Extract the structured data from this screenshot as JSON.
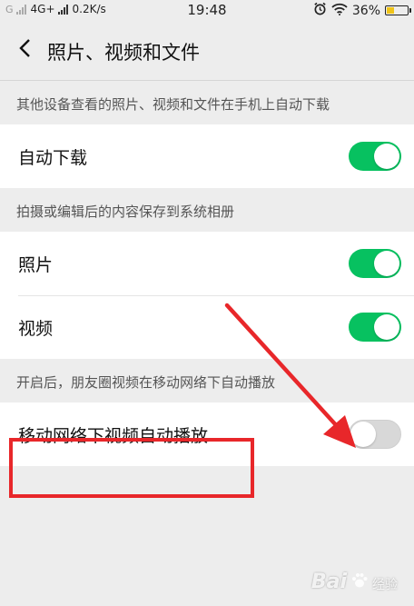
{
  "status_bar": {
    "carrier_g": "G",
    "network": "4G+",
    "speed": "0.2K/s",
    "time": "19:48",
    "battery": "36%"
  },
  "nav": {
    "title": "照片、视频和文件"
  },
  "sections": [
    {
      "header": "其他设备查看的照片、视频和文件在手机上自动下载",
      "items": [
        {
          "label": "自动下载",
          "on": true
        }
      ]
    },
    {
      "header": "拍摄或编辑后的内容保存到系统相册",
      "items": [
        {
          "label": "照片",
          "on": true
        },
        {
          "label": "视频",
          "on": true
        }
      ]
    },
    {
      "header": "开启后，朋友圈视频在移动网络下自动播放",
      "items": [
        {
          "label": "移动网络下视频自动播放",
          "on": false
        }
      ]
    }
  ],
  "colors": {
    "switch_on": "#07c160",
    "switch_off": "#d8d8d8",
    "annotation": "#e8272a"
  },
  "icons": {
    "back": "chevron-left-icon",
    "alarm": "alarm-clock-icon",
    "wifi": "wifi-icon",
    "battery": "battery-icon"
  },
  "watermark": {
    "brand": "Bai",
    "text": "经验"
  }
}
